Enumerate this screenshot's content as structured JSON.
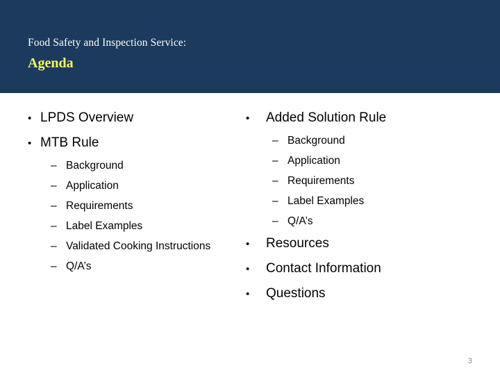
{
  "slide": {
    "number": "3",
    "background_color": "#ffffff"
  },
  "header": {
    "background_color": "#1b3a5e",
    "kicker": "Food Safety and Inspection Service:",
    "kicker_color": "#ffffff",
    "headline": "Agenda",
    "headline_color": "#f7f75c"
  },
  "body": {
    "bullet_glyph": "•",
    "dash_glyph": "–",
    "left_column": [
      {
        "level": 1,
        "text": "LPDS Overview"
      },
      {
        "level": 1,
        "text": "MTB Rule"
      },
      {
        "level": 2,
        "text": "Background"
      },
      {
        "level": 2,
        "text": "Application"
      },
      {
        "level": 2,
        "text": "Requirements"
      },
      {
        "level": 2,
        "text": "Label Examples"
      },
      {
        "level": 2,
        "text": "Validated Cooking Instructions"
      },
      {
        "level": 2,
        "text": "Q/A’s"
      }
    ],
    "right_column": [
      {
        "level": 1,
        "text": "Added Solution Rule"
      },
      {
        "level": 2,
        "text": "Background"
      },
      {
        "level": 2,
        "text": "Application"
      },
      {
        "level": 2,
        "text": "Requirements"
      },
      {
        "level": 2,
        "text": "Label Examples"
      },
      {
        "level": 2,
        "text": "Q/A’s"
      },
      {
        "level": 1,
        "text": "Resources"
      },
      {
        "level": 1,
        "text": "Contact Information"
      },
      {
        "level": 1,
        "text": "Questions"
      }
    ]
  }
}
